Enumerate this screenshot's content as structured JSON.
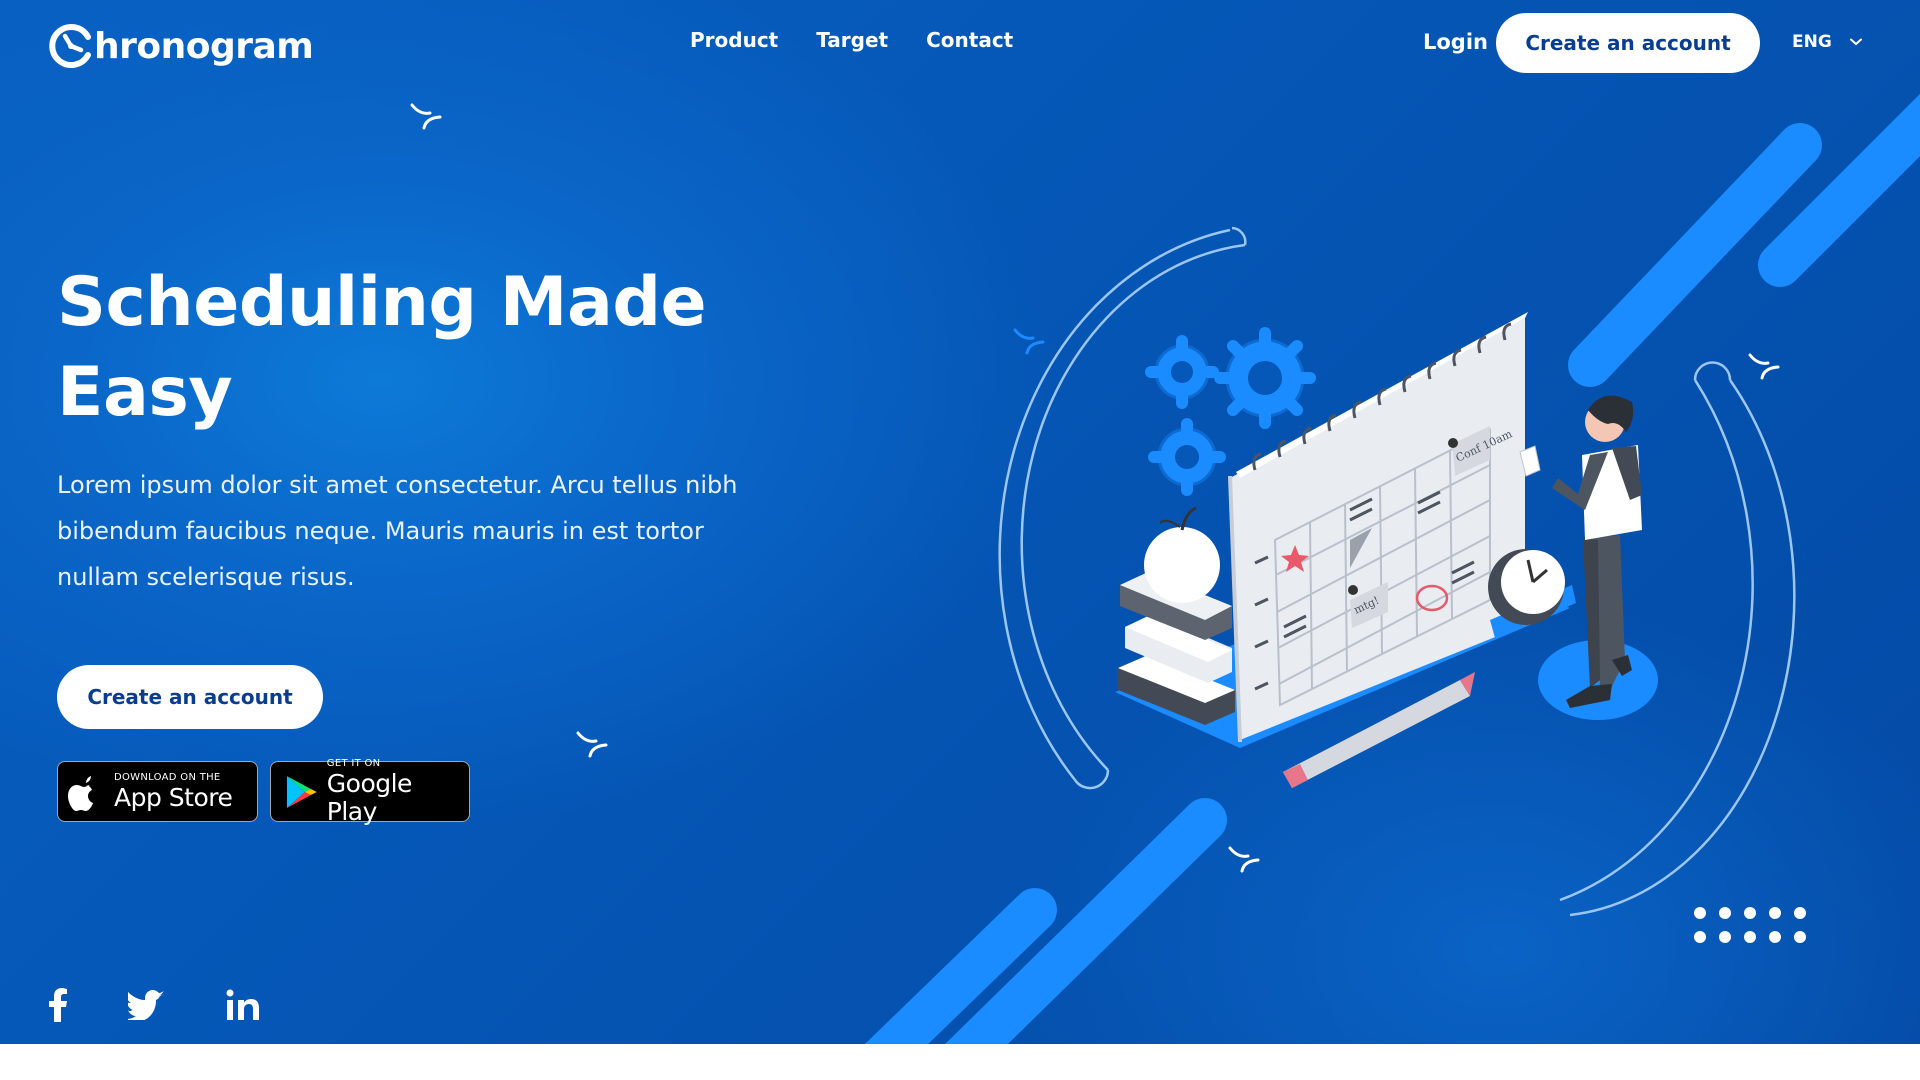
{
  "brand": {
    "name": "hronogram",
    "logo_icon": "clock-c-icon"
  },
  "nav": {
    "links": [
      "Product",
      "Target",
      "Contact"
    ],
    "login": "Login",
    "cta": "Create an account",
    "language": "ENG",
    "language_icon": "chevron-down-icon"
  },
  "hero": {
    "headline": "Scheduling Made Easy",
    "body": "Lorem ipsum dolor sit amet consectetur. Arcu tellus nibh bibendum faucibus neque. Mauris mauris in est tortor nullam scelerisque risus.",
    "cta": "Create an account"
  },
  "stores": {
    "apple": {
      "small": "DOWNLOAD ON THE",
      "big": "App Store",
      "icon": "apple-icon"
    },
    "google": {
      "small": "GET IT ON",
      "big": "Google Play",
      "icon": "google-play-icon"
    }
  },
  "social": [
    "facebook-icon",
    "twitter-icon",
    "linkedin-icon"
  ],
  "illustration": {
    "note_text": "Conf 10am",
    "mtg_text": "mtg!"
  },
  "colors": {
    "background": "#0557b8",
    "accent": "#1a8cff",
    "button_bg": "#ffffff",
    "button_text": "#0a3d8f"
  }
}
